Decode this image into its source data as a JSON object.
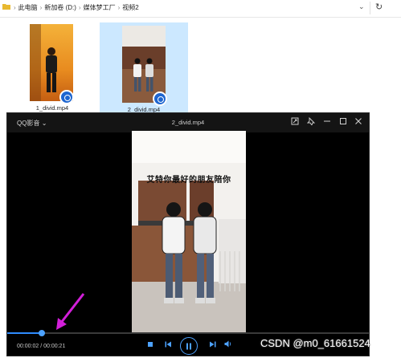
{
  "explorer": {
    "breadcrumb": [
      "此电脑",
      "新加卷 (D:)",
      "媒体梦工厂",
      "视频2"
    ]
  },
  "files": [
    {
      "name": "1_divid.mp4",
      "selected": false
    },
    {
      "name": "2_divid.mp4",
      "selected": true
    }
  ],
  "player": {
    "app_name": "QQ影音",
    "file_name": "2_divid.mp4",
    "video_caption": "艾特你最好的朋友陪你",
    "time_display": "00:00:02 / 00:00:21",
    "progress_fraction": 0.095,
    "accent_color": "#2f8cff"
  },
  "icons": [
    "folder-icon",
    "chevron-down-icon",
    "refresh-icon",
    "pin-icon",
    "minimize-icon",
    "maximize-icon",
    "close-icon",
    "stop-icon",
    "previous-icon",
    "play-pause-icon",
    "next-icon",
    "volume-icon"
  ],
  "watermark": "CSDN @m0_61661524"
}
